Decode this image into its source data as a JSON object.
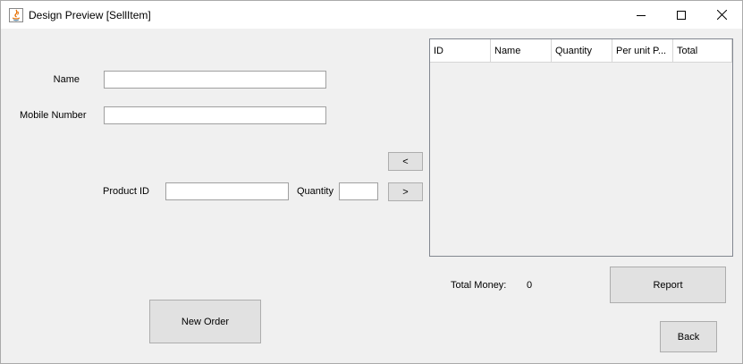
{
  "window": {
    "title": "Design Preview [SellItem]",
    "minimize_icon": "minimize-icon",
    "maximize_icon": "maximize-icon",
    "close_icon": "close-icon",
    "app_icon": "java-icon"
  },
  "form": {
    "name_label": "Name",
    "name_value": "",
    "mobile_label": "Mobile Number",
    "mobile_value": "",
    "product_id_label": "Product ID",
    "product_id_value": "",
    "quantity_label": "Quantity",
    "quantity_value": ""
  },
  "buttons": {
    "remove": "<",
    "add": ">",
    "new_order": "New Order",
    "report": "Report",
    "back": "Back"
  },
  "table": {
    "columns": [
      "ID",
      "Name",
      "Quantity",
      "Per unit P...",
      "Total"
    ],
    "rows": []
  },
  "summary": {
    "total_money_label": "Total Money:",
    "total_money_value": "0"
  }
}
